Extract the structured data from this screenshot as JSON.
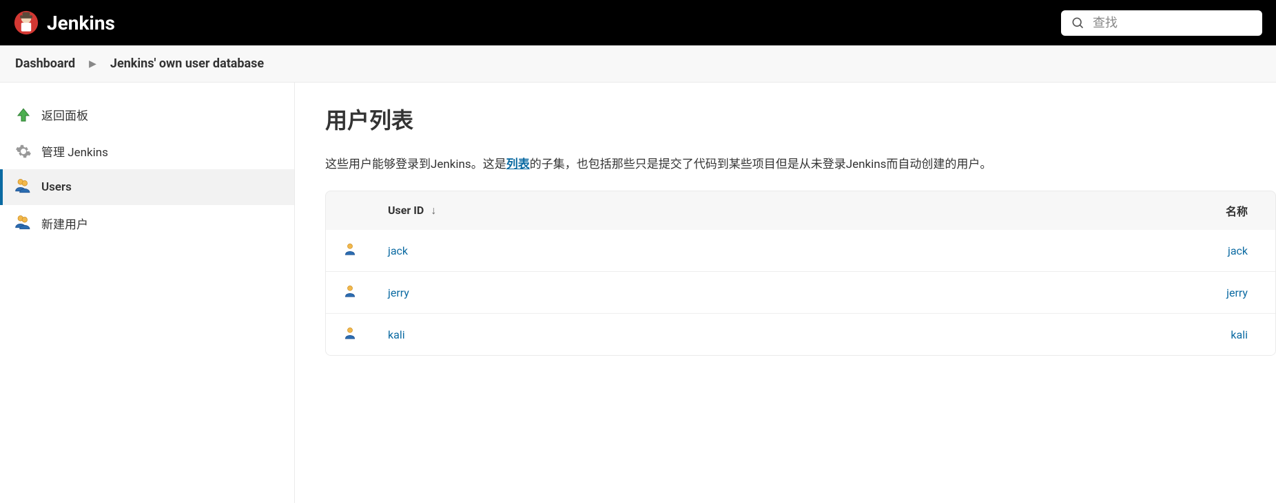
{
  "header": {
    "title": "Jenkins",
    "search_placeholder": "查找"
  },
  "breadcrumb": [
    {
      "label": "Dashboard"
    },
    {
      "label": "Jenkins' own user database"
    }
  ],
  "sidebar": {
    "items": [
      {
        "label": "返回面板",
        "icon": "arrow-up",
        "selected": false
      },
      {
        "label": "管理 Jenkins",
        "icon": "gear",
        "selected": false
      },
      {
        "label": "Users",
        "icon": "users",
        "selected": true
      },
      {
        "label": "新建用户",
        "icon": "users",
        "selected": false
      }
    ]
  },
  "main": {
    "title": "用户列表",
    "desc_before": "这些用户能够登录到Jenkins。这是",
    "desc_link": "列表",
    "desc_after": "的子集，也包括那些只是提交了代码到某些项目但是从未登录Jenkins而自动创建的用户。",
    "columns": {
      "id": "User ID",
      "sort_indicator": "↓",
      "name": "名称"
    },
    "users": [
      {
        "id": "jack",
        "name": "jack"
      },
      {
        "id": "jerry",
        "name": "jerry"
      },
      {
        "id": "kali",
        "name": "kali"
      }
    ]
  }
}
